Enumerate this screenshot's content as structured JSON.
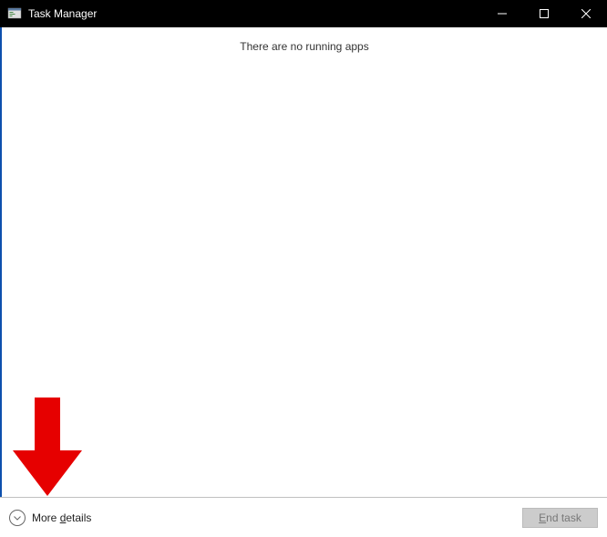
{
  "window": {
    "title": "Task Manager"
  },
  "content": {
    "empty_message": "There are no running apps"
  },
  "footer": {
    "more_details_prefix": "More ",
    "more_details_underline": "d",
    "more_details_suffix": "etails",
    "end_task_underline": "E",
    "end_task_suffix": "nd task"
  }
}
